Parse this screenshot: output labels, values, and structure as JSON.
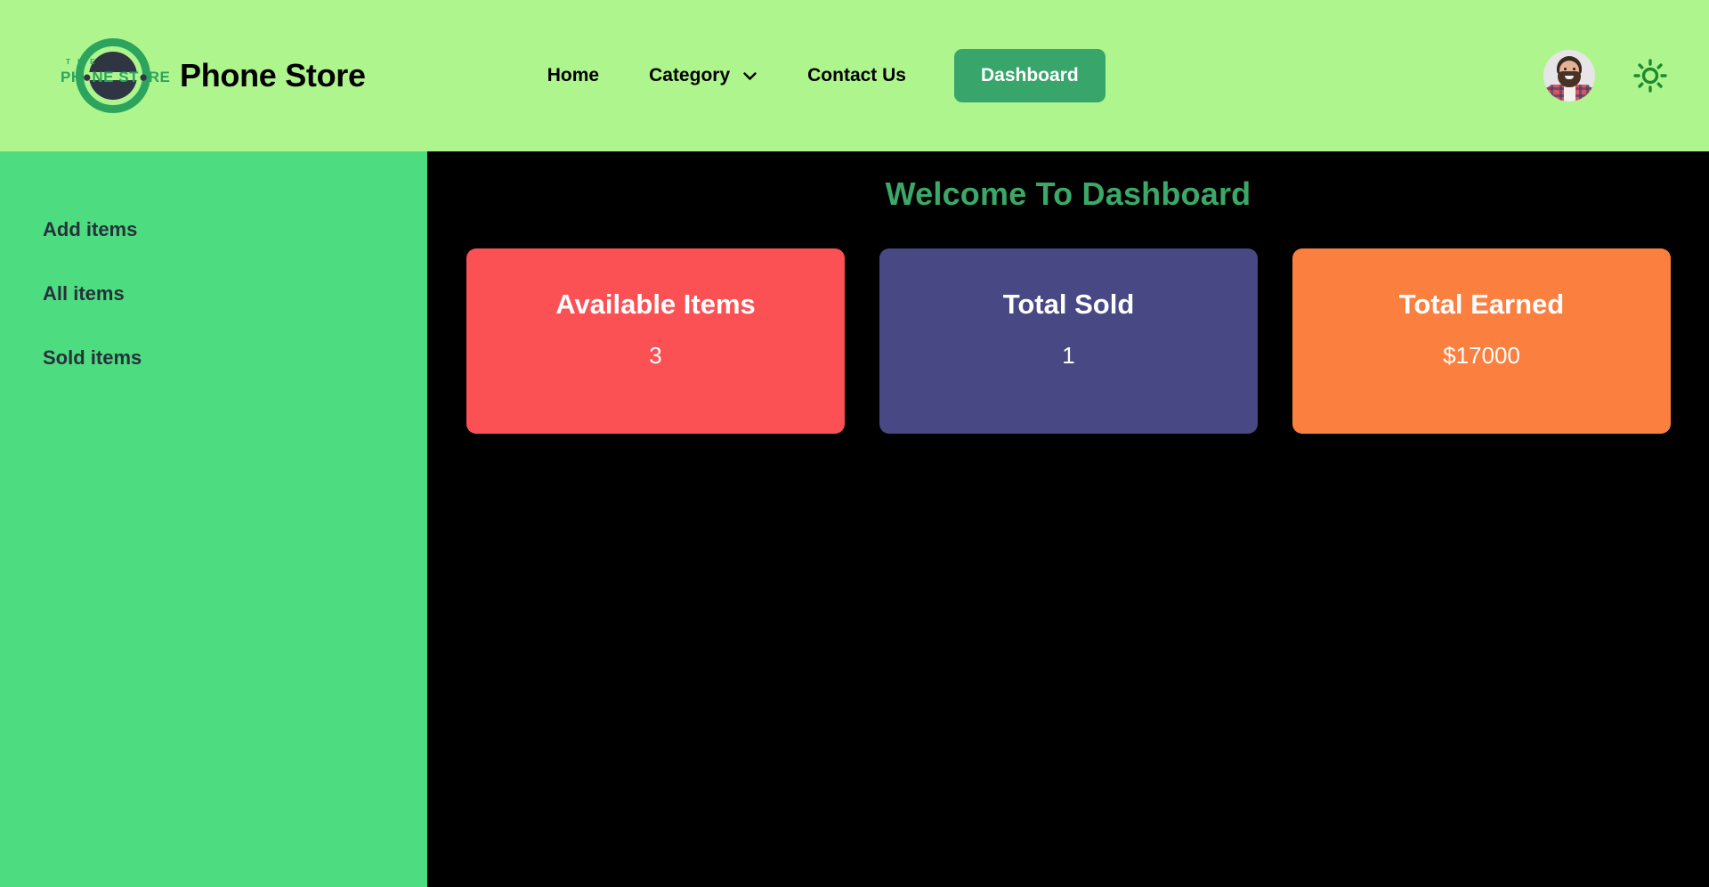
{
  "header": {
    "logo": {
      "name": "phone-store-logo",
      "the_text": "T H E",
      "word_prefix": "PH",
      "word_mid": "NE ST",
      "word_suffix": "RE"
    },
    "brand_title": "Phone Store",
    "nav": [
      {
        "label": "Home",
        "name": "nav-home",
        "has_chevron": false
      },
      {
        "label": "Category",
        "name": "nav-category",
        "has_chevron": true
      },
      {
        "label": "Contact Us",
        "name": "nav-contact-us",
        "has_chevron": false
      }
    ],
    "dashboard_button": "Dashboard",
    "avatar_alt": "user-avatar",
    "theme_toggle_icon": "sun-icon",
    "colors": {
      "header_bg": "#AEF58D",
      "dashboard_btn_bg": "#38A66B",
      "logo_green": "#2CA45E",
      "sun_green": "#1E8A2E"
    }
  },
  "sidebar": {
    "bg": "#4EDC80",
    "items": [
      {
        "label": "Add items",
        "name": "sidebar-item-add-items"
      },
      {
        "label": "All items",
        "name": "sidebar-item-all-items"
      },
      {
        "label": "Sold items",
        "name": "sidebar-item-sold-items"
      }
    ]
  },
  "main": {
    "bg": "#000000",
    "welcome_title": "Welcome To Dashboard",
    "welcome_color": "#3BA868",
    "cards": [
      {
        "name": "stat-card-available-items",
        "title": "Available Items",
        "value": "3",
        "color": "#FB5155"
      },
      {
        "name": "stat-card-total-sold",
        "title": "Total Sold",
        "value": "1",
        "color": "#474884"
      },
      {
        "name": "stat-card-total-earned",
        "title": "Total Earned",
        "value": "$17000",
        "color": "#FB7F3F"
      }
    ]
  }
}
